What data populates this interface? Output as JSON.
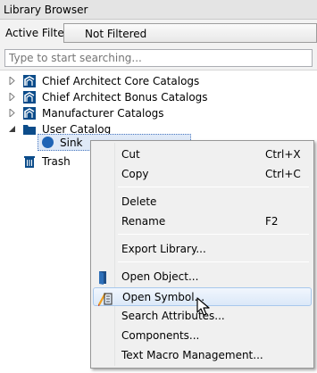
{
  "window": {
    "title": "Library Browser"
  },
  "filter": {
    "label": "Active Filter:",
    "value": "Not Filtered"
  },
  "search": {
    "placeholder": "Type to start searching..."
  },
  "tree": {
    "items": [
      {
        "label": "Chief Architect Core Catalogs",
        "icon": "catalog-icon",
        "expanded": false
      },
      {
        "label": "Chief Architect Bonus Catalogs",
        "icon": "catalog-icon",
        "expanded": false
      },
      {
        "label": "Manufacturer Catalogs",
        "icon": "catalog-icon",
        "expanded": false
      },
      {
        "label": "User Catalog",
        "icon": "folder-icon",
        "expanded": true
      },
      {
        "label": "Sink",
        "icon": "sink-icon",
        "selected": true
      },
      {
        "label": "Trash",
        "icon": "trash-icon"
      }
    ]
  },
  "context_menu": {
    "items": [
      {
        "label": "Cut",
        "shortcut": "Ctrl+X"
      },
      {
        "label": "Copy",
        "shortcut": "Ctrl+C"
      },
      {
        "label": "Delete",
        "shortcut": ""
      },
      {
        "label": "Rename",
        "shortcut": "F2"
      },
      {
        "label": "Export Library...",
        "shortcut": ""
      },
      {
        "label": "Open Object...",
        "shortcut": "",
        "icon": "open-object-icon"
      },
      {
        "label": "Open Symbol...",
        "shortcut": "",
        "icon": "open-symbol-icon",
        "hovered": true
      },
      {
        "label": "Search Attributes...",
        "shortcut": ""
      },
      {
        "label": "Components...",
        "shortcut": ""
      },
      {
        "label": "Text Macro Management...",
        "shortcut": ""
      }
    ]
  },
  "colors": {
    "accent": "#1f64b5",
    "selection": "#dfe9f7",
    "menu_bg": "#f0f0f0",
    "hover": "#dbe8f8"
  }
}
